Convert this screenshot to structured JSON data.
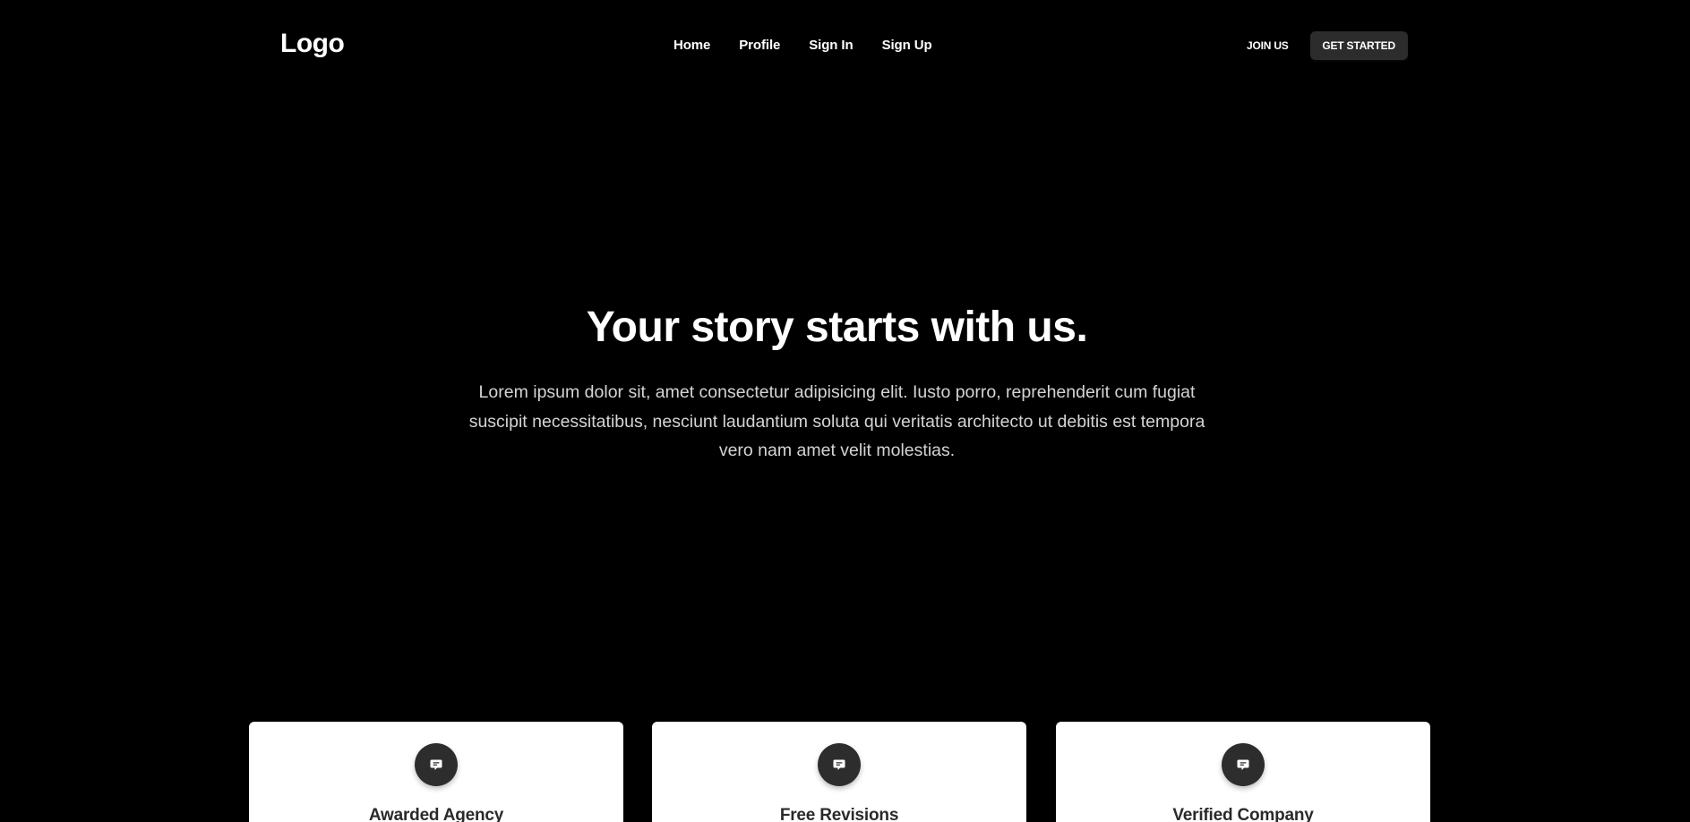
{
  "navbar": {
    "logo": "Logo",
    "links": [
      "Home",
      "Profile",
      "Sign In",
      "Sign Up"
    ],
    "join_label": "JOIN US",
    "started_label": "GET STARTED"
  },
  "hero": {
    "title": "Your story starts with us.",
    "text": "Lorem ipsum dolor sit, amet consectetur adipisicing elit. Iusto porro, reprehenderit cum fugiat suscipit necessitatibus, nesciunt laudantium soluta qui veritatis architecto ut debitis est tempora vero nam amet velit molestias."
  },
  "cards": [
    {
      "title": "Awarded Agency",
      "icon": "chat-bubble-icon"
    },
    {
      "title": "Free Revisions",
      "icon": "chat-bubble-icon"
    },
    {
      "title": "Verified Company",
      "icon": "chat-bubble-icon"
    }
  ],
  "colors": {
    "background": "#000000",
    "button_dark": "#2c2c2c",
    "icon_circle": "#2d2d2d",
    "card": "#ffffff"
  }
}
